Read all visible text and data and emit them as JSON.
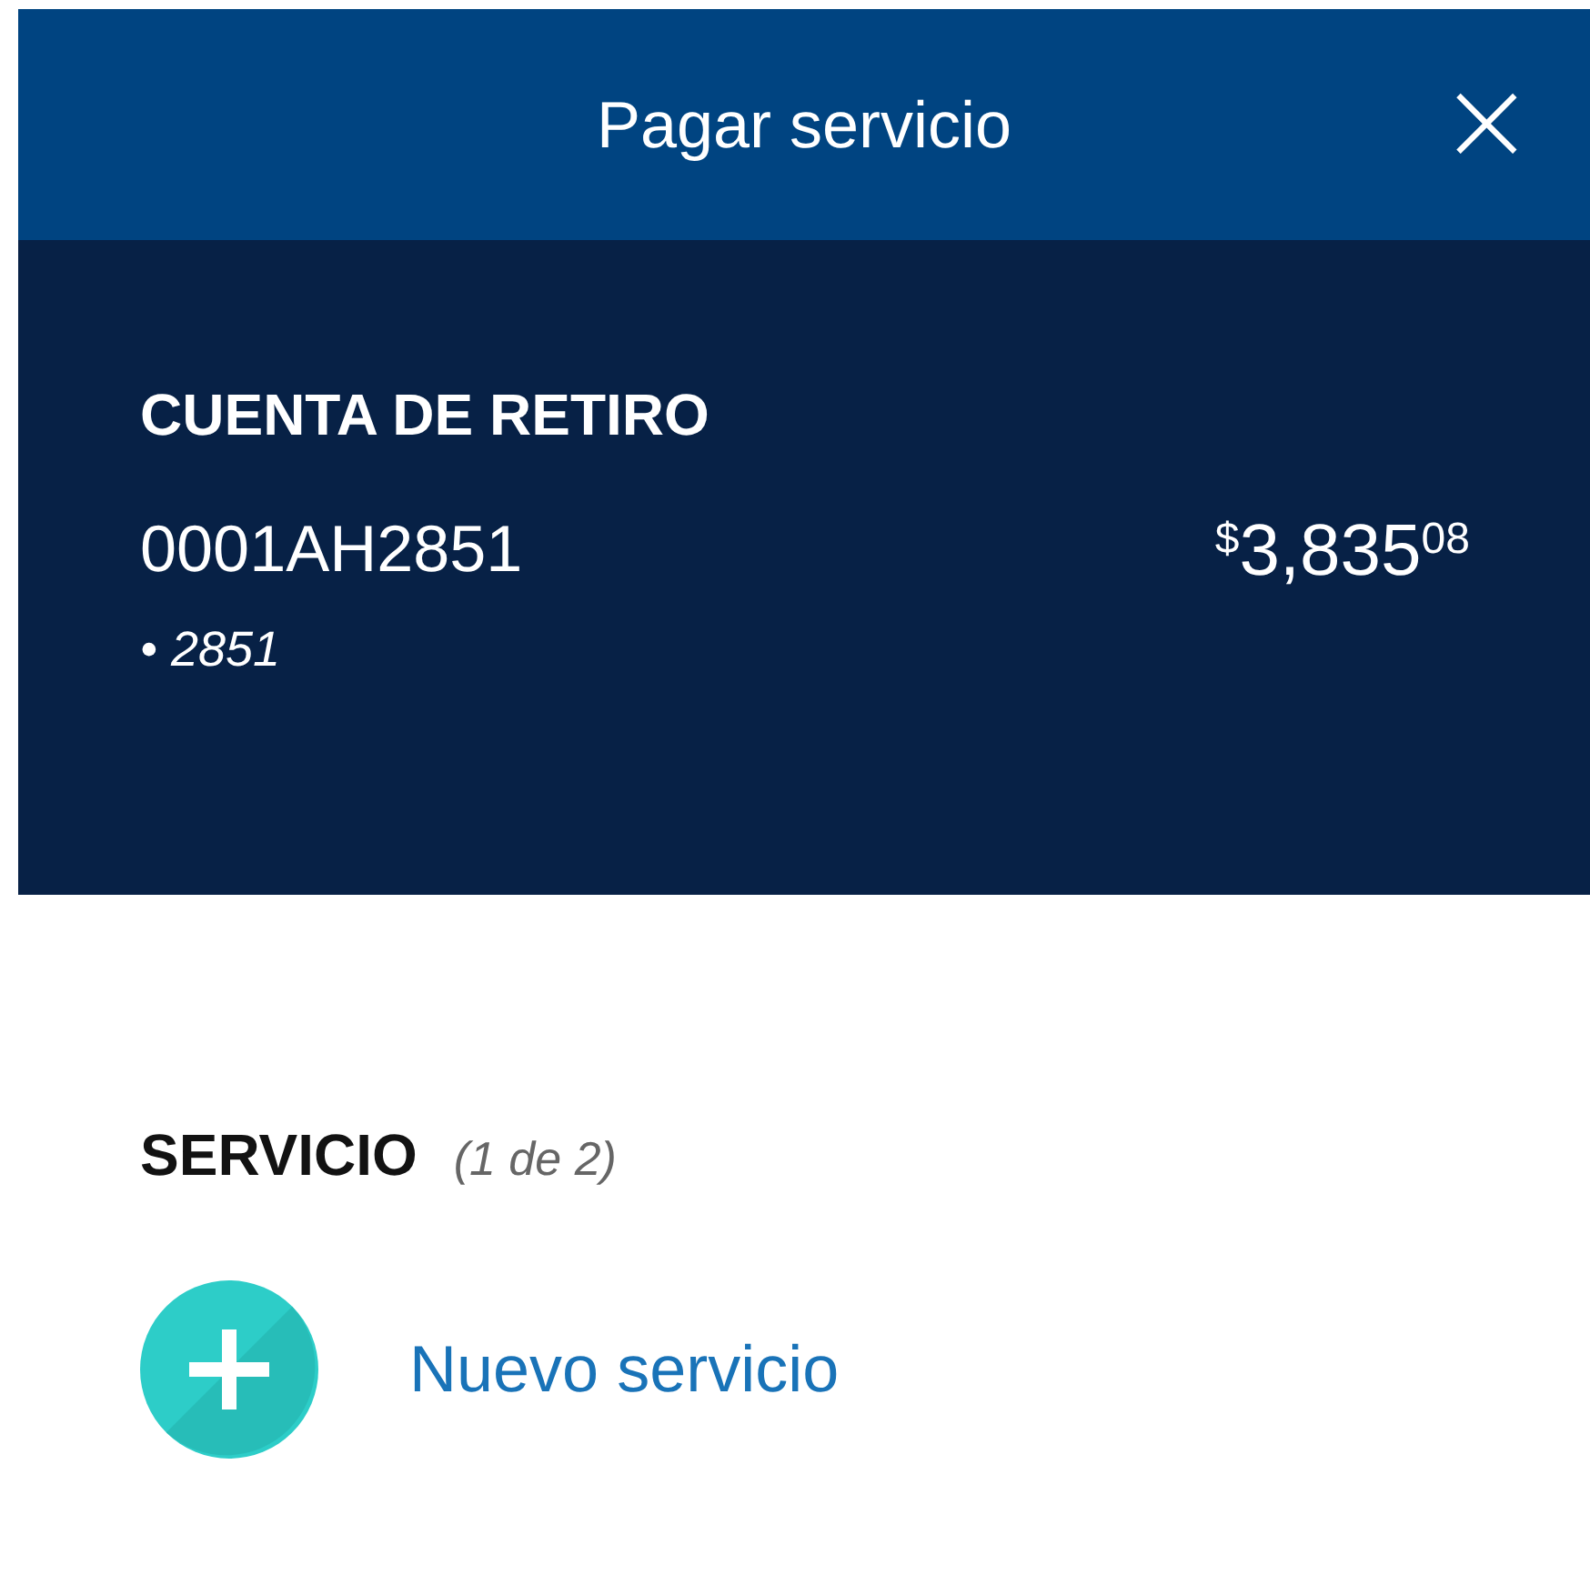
{
  "header": {
    "title": "Pagar servicio",
    "close": "×"
  },
  "account": {
    "label": "CUENTA DE RETIRO",
    "number": "0001AH2851",
    "suffix": "• 2851",
    "amount": {
      "currency": "$",
      "integer": "3,835",
      "cents": "08"
    }
  },
  "service": {
    "label": "SERVICIO",
    "count": "(1 de 2)",
    "new_label": "Nuevo servicio"
  }
}
